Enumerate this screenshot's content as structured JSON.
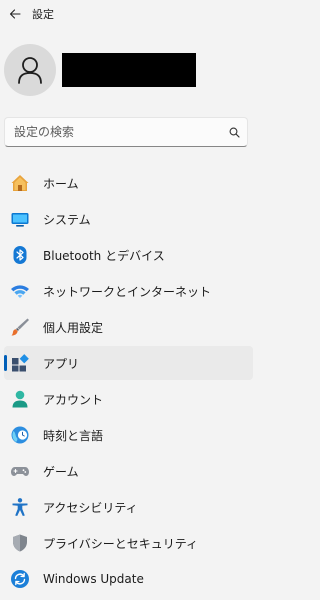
{
  "titlebar": {
    "title": "設定",
    "back_icon": "back-arrow-icon"
  },
  "profile": {
    "avatar_icon": "person-icon"
  },
  "search": {
    "placeholder": "設定の検索",
    "icon": "search-icon"
  },
  "nav": {
    "items": [
      {
        "id": "home",
        "label": "ホーム",
        "icon": "home-icon",
        "selected": false
      },
      {
        "id": "system",
        "label": "システム",
        "icon": "display-icon",
        "selected": false
      },
      {
        "id": "bluetooth",
        "label": "Bluetooth とデバイス",
        "icon": "bluetooth-icon",
        "selected": false
      },
      {
        "id": "network",
        "label": "ネットワークとインターネット",
        "icon": "wifi-icon",
        "selected": false
      },
      {
        "id": "personalization",
        "label": "個人用設定",
        "icon": "paintbrush-icon",
        "selected": false
      },
      {
        "id": "apps",
        "label": "アプリ",
        "icon": "apps-icon",
        "selected": true
      },
      {
        "id": "accounts",
        "label": "アカウント",
        "icon": "account-icon",
        "selected": false
      },
      {
        "id": "time-language",
        "label": "時刻と言語",
        "icon": "clock-globe-icon",
        "selected": false
      },
      {
        "id": "gaming",
        "label": "ゲーム",
        "icon": "gamepad-icon",
        "selected": false
      },
      {
        "id": "accessibility",
        "label": "アクセシビリティ",
        "icon": "accessibility-icon",
        "selected": false
      },
      {
        "id": "privacy",
        "label": "プライバシーとセキュリティ",
        "icon": "shield-icon",
        "selected": false
      },
      {
        "id": "windows-update",
        "label": "Windows Update",
        "icon": "update-icon",
        "selected": false
      }
    ]
  },
  "colors": {
    "accent": "#005fb8",
    "background": "#f3f3f3",
    "selected_bg": "#eaeaea"
  }
}
